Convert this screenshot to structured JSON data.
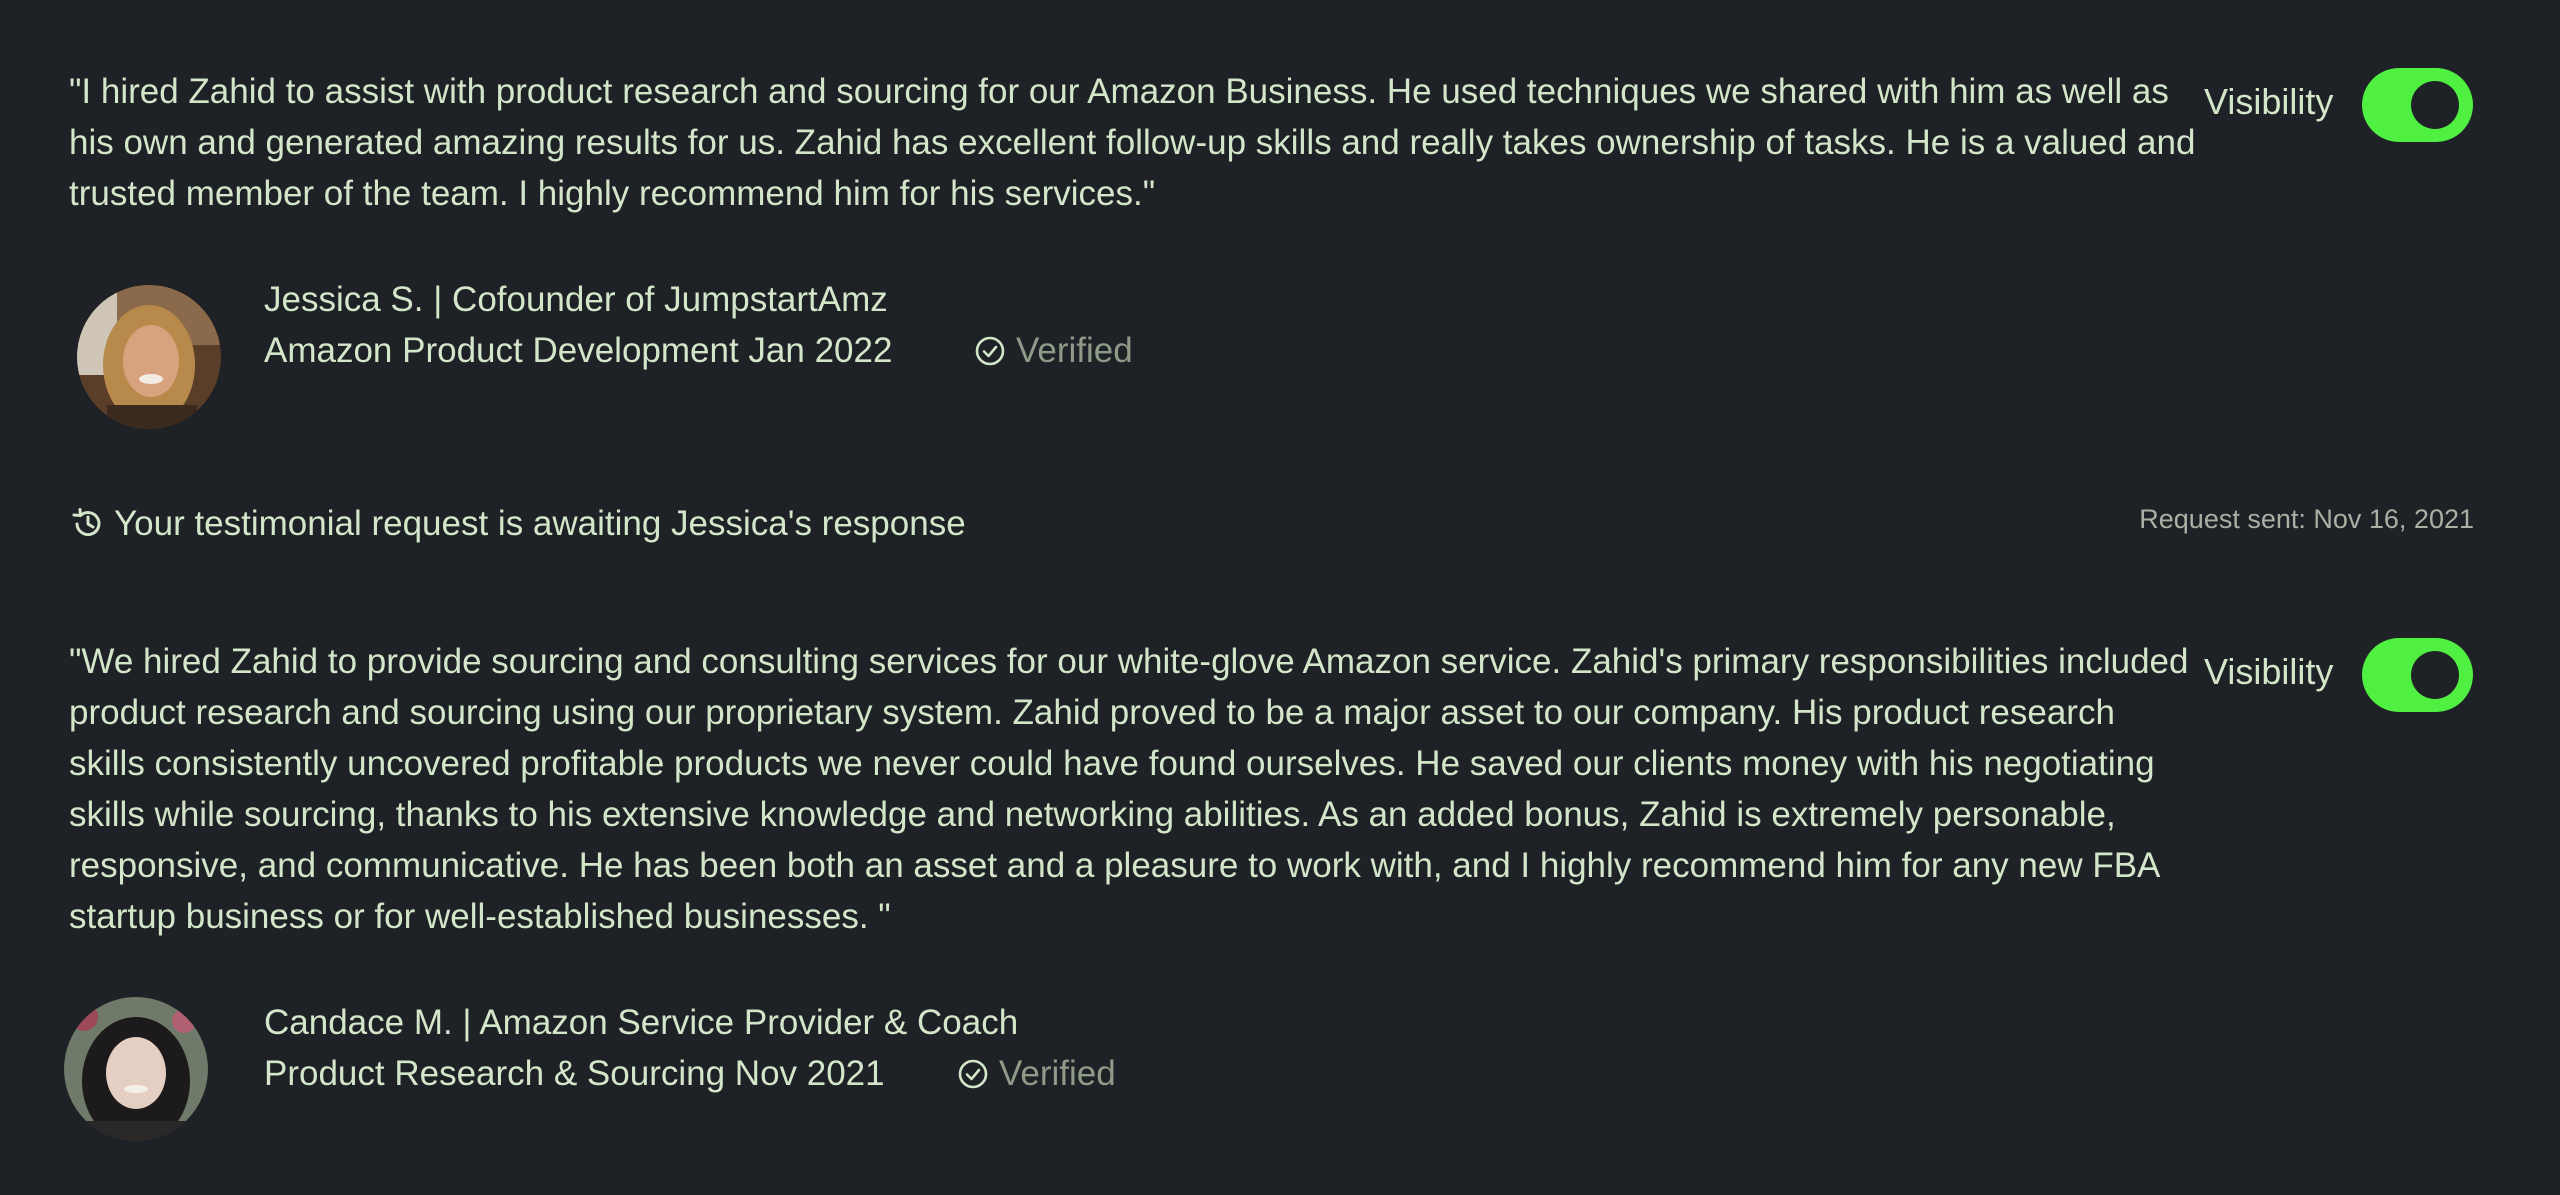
{
  "testimonials": [
    {
      "quote": "\"I hired Zahid to assist with product research and sourcing for our Amazon Business. He used techniques we shared with him as well as his own and generated amazing results for us. Zahid has excellent follow-up skills and really takes ownership of tasks. He is a valued and trusted member of the team. I highly recommend him for his services.\"",
      "visibility_label": "Visibility",
      "visibility_on": true,
      "author": "Jessica S. | Cofounder of JumpstartAmz",
      "project": "Amazon Product Development Jan 2022",
      "verified_label": "Verified"
    },
    {
      "quote": "\"We hired Zahid to provide sourcing and consulting services for our white-glove Amazon service. Zahid's primary responsibilities included product research and sourcing using our proprietary system. Zahid proved to be a major asset to our company. His product research skills consistently uncovered profitable products we never could have found ourselves. He saved our clients money with his negotiating skills while sourcing, thanks to his extensive knowledge and networking abilities. As an added bonus, Zahid is extremely personable, responsive, and communicative. He has been both an asset and a pleasure to work with, and I highly recommend him for any new FBA startup business or for well-established businesses. \"",
      "visibility_label": "Visibility",
      "visibility_on": true,
      "author": "Candace M. | Amazon Service Provider & Coach",
      "project": "Product Research & Sourcing Nov 2021",
      "verified_label": "Verified"
    }
  ],
  "pending_request": {
    "message": "Your testimonial request is awaiting Jessica's response",
    "sent_label": "Request sent: Nov 16, 2021",
    "icon": "history-icon"
  },
  "colors": {
    "background": "#1e2125",
    "text": "#d3e6c9",
    "muted": "#8d9b88",
    "toggle_on": "#4ff041"
  }
}
